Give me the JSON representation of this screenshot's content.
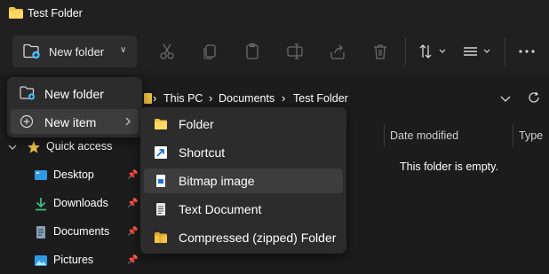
{
  "window": {
    "title": "Test Folder"
  },
  "toolbar": {
    "new_folder_label": "New folder",
    "icons": [
      "cut-icon",
      "copy-icon",
      "paste-icon",
      "rename-icon",
      "share-icon",
      "delete-icon",
      "sort-icon",
      "view-icon",
      "more-icon"
    ]
  },
  "address": {
    "crumbs": [
      "This PC",
      "Documents",
      "Test Folder"
    ]
  },
  "columns": {
    "date_modified": "Date modified",
    "type": "Type"
  },
  "content": {
    "empty_message": "This folder is empty."
  },
  "nav": {
    "quick_access": "Quick access",
    "items": [
      {
        "label": "Desktop",
        "icon": "desktop-icon"
      },
      {
        "label": "Downloads",
        "icon": "downloads-icon"
      },
      {
        "label": "Documents",
        "icon": "documents-icon"
      },
      {
        "label": "Pictures",
        "icon": "pictures-icon"
      }
    ]
  },
  "new_menu": {
    "items": [
      {
        "label": "New folder"
      },
      {
        "label": "New item"
      }
    ]
  },
  "new_item_menu": {
    "items": [
      {
        "label": "Folder",
        "icon": "folder-icon"
      },
      {
        "label": "Shortcut",
        "icon": "shortcut-icon"
      },
      {
        "label": "Bitmap image",
        "icon": "bitmap-icon"
      },
      {
        "label": "Text Document",
        "icon": "text-document-icon"
      },
      {
        "label": "Compressed (zipped) Folder",
        "icon": "zip-folder-icon"
      }
    ]
  },
  "colors": {
    "accent": "#4cc2ff",
    "folder": "#f5c542"
  }
}
